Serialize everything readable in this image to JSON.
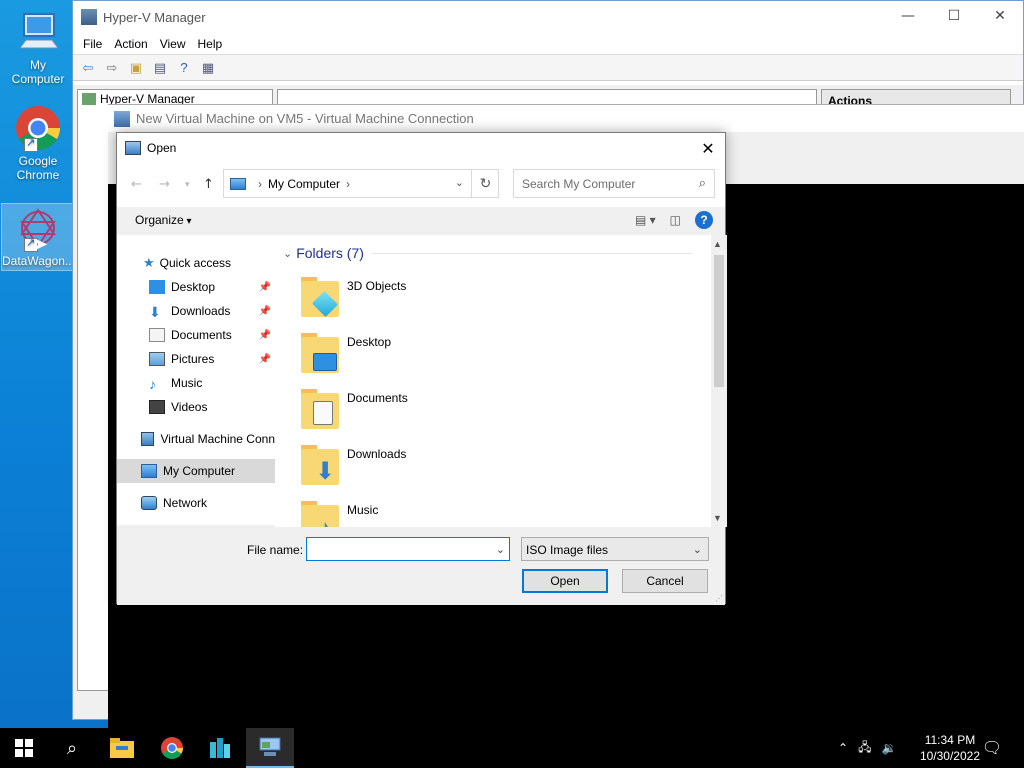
{
  "desktop": {
    "icons": [
      {
        "label": "My Computer"
      },
      {
        "label": "Google Chrome"
      },
      {
        "label": "DataWagon..."
      }
    ]
  },
  "hyperv": {
    "title": "Hyper-V Manager",
    "menu": [
      "File",
      "Action",
      "View",
      "Help"
    ],
    "tree_root": "Hyper-V Manager",
    "actions_header": "Actions"
  },
  "vmconnect": {
    "title": "New Virtual Machine on VM5 - Virtual Machine Connection"
  },
  "dialog": {
    "title": "Open",
    "address": "My Computer",
    "search_placeholder": "Search My Computer",
    "organize": "Organize",
    "nav": {
      "quick_access": "Quick access",
      "items": [
        "Desktop",
        "Downloads",
        "Documents",
        "Pictures",
        "Music",
        "Videos"
      ],
      "vmc": "Virtual Machine Conn",
      "my_computer": "My Computer",
      "network": "Network"
    },
    "group_label": "Folders (7)",
    "folders": [
      "3D Objects",
      "Desktop",
      "Documents",
      "Downloads",
      "Music"
    ],
    "filename_label": "File name:",
    "filename_value": "",
    "filter": "ISO Image files",
    "open_label": "Open",
    "cancel_label": "Cancel"
  },
  "taskbar": {
    "time": "11:34 PM",
    "date": "10/30/2022"
  },
  "colors": {
    "accent": "#0078d7",
    "desktop": "#0b80d6",
    "folder": "#f8d775"
  }
}
